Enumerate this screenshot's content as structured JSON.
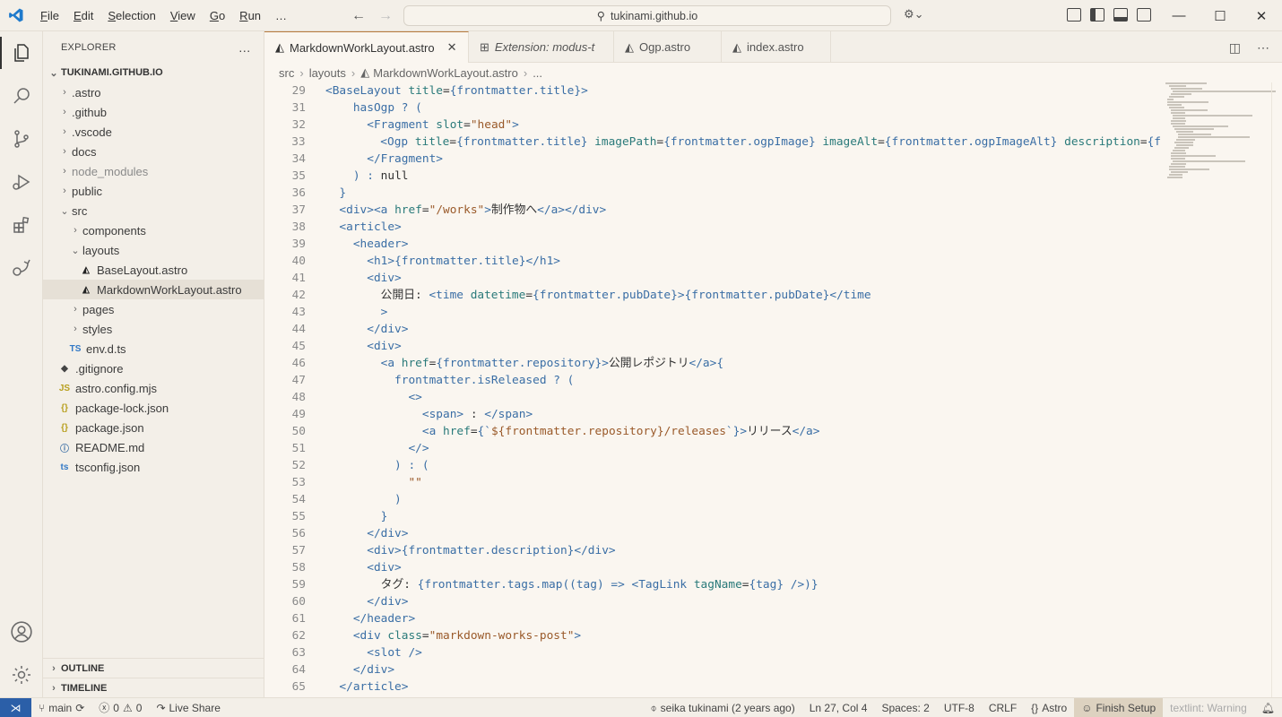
{
  "menu": [
    "File",
    "Edit",
    "Selection",
    "View",
    "Go",
    "Run",
    "…"
  ],
  "menu_mnemonics": [
    "F",
    "E",
    "S",
    "V",
    "G",
    "R",
    ""
  ],
  "search": {
    "text": "tukinami.github.io"
  },
  "sidebar": {
    "header": "EXPLORER",
    "more": "…",
    "root": "TUKINAMI.GITHUB.IO",
    "items": [
      {
        "label": ".astro",
        "type": "folder",
        "depth": 1,
        "open": false
      },
      {
        "label": ".github",
        "type": "folder",
        "depth": 1,
        "open": false
      },
      {
        "label": ".vscode",
        "type": "folder",
        "depth": 1,
        "open": false
      },
      {
        "label": "docs",
        "type": "folder",
        "depth": 1,
        "open": false
      },
      {
        "label": "node_modules",
        "type": "folder",
        "depth": 1,
        "open": false,
        "dim": true
      },
      {
        "label": "public",
        "type": "folder",
        "depth": 1,
        "open": false
      },
      {
        "label": "src",
        "type": "folder",
        "depth": 1,
        "open": true
      },
      {
        "label": "components",
        "type": "folder",
        "depth": 2,
        "open": false
      },
      {
        "label": "layouts",
        "type": "folder",
        "depth": 2,
        "open": true
      },
      {
        "label": "BaseLayout.astro",
        "type": "astro",
        "depth": 3
      },
      {
        "label": "MarkdownWorkLayout.astro",
        "type": "astro",
        "depth": 3,
        "selected": true
      },
      {
        "label": "pages",
        "type": "folder",
        "depth": 2,
        "open": false
      },
      {
        "label": "styles",
        "type": "folder",
        "depth": 2,
        "open": false
      },
      {
        "label": "env.d.ts",
        "type": "ts",
        "depth": 2
      },
      {
        "label": ".gitignore",
        "type": "git",
        "depth": 1
      },
      {
        "label": "astro.config.mjs",
        "type": "js",
        "depth": 1
      },
      {
        "label": "package-lock.json",
        "type": "json",
        "depth": 1
      },
      {
        "label": "package.json",
        "type": "json",
        "depth": 1
      },
      {
        "label": "README.md",
        "type": "info",
        "depth": 1
      },
      {
        "label": "tsconfig.json",
        "type": "tsconfig",
        "depth": 1
      }
    ],
    "outline": "OUTLINE",
    "timeline": "TIMELINE"
  },
  "tabs": [
    {
      "label": "MarkdownWorkLayout.astro",
      "active": true,
      "italic": false,
      "icon": "astro-icon"
    },
    {
      "label": "Extension: modus-t",
      "active": false,
      "italic": true,
      "icon": "extension-icon"
    },
    {
      "label": "Ogp.astro",
      "active": false,
      "italic": false,
      "icon": "astro-icon"
    },
    {
      "label": "index.astro",
      "active": false,
      "italic": false,
      "icon": "astro-icon"
    }
  ],
  "breadcrumb": [
    "src",
    "layouts",
    "MarkdownWorkLayout.astro",
    "..."
  ],
  "code": [
    {
      "n": "29",
      "indent": 0,
      "parts": [
        [
          "tag",
          "<BaseLayout "
        ],
        [
          "attr",
          "title"
        ],
        [
          "plain",
          "="
        ],
        [
          "expr",
          "{frontmatter.title}"
        ],
        [
          "tag",
          ">"
        ]
      ]
    },
    {
      "n": "31",
      "indent": 2,
      "parts": [
        [
          "expr",
          "hasOgp ? ("
        ]
      ]
    },
    {
      "n": "32",
      "indent": 3,
      "parts": [
        [
          "tag",
          "<Fragment "
        ],
        [
          "attr",
          "slot"
        ],
        [
          "plain",
          "="
        ],
        [
          "str",
          "\"head\""
        ],
        [
          "tag",
          ">"
        ]
      ]
    },
    {
      "n": "33",
      "indent": 4,
      "parts": [
        [
          "tag",
          "<Ogp "
        ],
        [
          "attr",
          "title"
        ],
        [
          "plain",
          "="
        ],
        [
          "expr",
          "{frontmatter.title} "
        ],
        [
          "attr",
          "imagePath"
        ],
        [
          "plain",
          "="
        ],
        [
          "expr",
          "{frontmatter.ogpImage} "
        ],
        [
          "attr",
          "imageAlt"
        ],
        [
          "plain",
          "="
        ],
        [
          "expr",
          "{frontmatter.ogpImageAlt} "
        ],
        [
          "attr",
          "description"
        ],
        [
          "plain",
          "="
        ],
        [
          "expr",
          "{f"
        ]
      ]
    },
    {
      "n": "34",
      "indent": 3,
      "parts": [
        [
          "tag",
          "</Fragment>"
        ]
      ]
    },
    {
      "n": "35",
      "indent": 2,
      "parts": [
        [
          "expr",
          ") : "
        ],
        [
          "plain",
          "null"
        ]
      ]
    },
    {
      "n": "36",
      "indent": 1,
      "parts": [
        [
          "expr",
          "}"
        ]
      ]
    },
    {
      "n": "37",
      "indent": 1,
      "parts": [
        [
          "tag",
          "<div><a "
        ],
        [
          "attr",
          "href"
        ],
        [
          "plain",
          "="
        ],
        [
          "str",
          "\"/works\""
        ],
        [
          "tag",
          ">"
        ],
        [
          "plain",
          "制作物へ"
        ],
        [
          "tag",
          "</a></div>"
        ]
      ]
    },
    {
      "n": "38",
      "indent": 1,
      "parts": [
        [
          "tag",
          "<article>"
        ]
      ]
    },
    {
      "n": "39",
      "indent": 2,
      "parts": [
        [
          "tag",
          "<header>"
        ]
      ]
    },
    {
      "n": "40",
      "indent": 3,
      "parts": [
        [
          "tag",
          "<h1>"
        ],
        [
          "expr",
          "{frontmatter.title}"
        ],
        [
          "tag",
          "</h1>"
        ]
      ]
    },
    {
      "n": "41",
      "indent": 3,
      "parts": [
        [
          "tag",
          "<div>"
        ]
      ]
    },
    {
      "n": "42",
      "indent": 4,
      "parts": [
        [
          "plain",
          "公開日: "
        ],
        [
          "tag",
          "<time "
        ],
        [
          "attr",
          "datetime"
        ],
        [
          "plain",
          "="
        ],
        [
          "expr",
          "{frontmatter.pubDate}"
        ],
        [
          "tag",
          ">"
        ],
        [
          "expr",
          "{frontmatter.pubDate}"
        ],
        [
          "tag",
          "</time"
        ]
      ]
    },
    {
      "n": "43",
      "indent": 4,
      "parts": [
        [
          "tag",
          ">"
        ]
      ]
    },
    {
      "n": "44",
      "indent": 3,
      "parts": [
        [
          "tag",
          "</div>"
        ]
      ]
    },
    {
      "n": "45",
      "indent": 3,
      "parts": [
        [
          "tag",
          "<div>"
        ]
      ]
    },
    {
      "n": "46",
      "indent": 4,
      "parts": [
        [
          "tag",
          "<a "
        ],
        [
          "attr",
          "href"
        ],
        [
          "plain",
          "="
        ],
        [
          "expr",
          "{frontmatter.repository}"
        ],
        [
          "tag",
          ">"
        ],
        [
          "plain",
          "公開レポジトリ"
        ],
        [
          "tag",
          "</a>"
        ],
        [
          "expr",
          "{"
        ]
      ]
    },
    {
      "n": "47",
      "indent": 5,
      "parts": [
        [
          "expr",
          "frontmatter.isReleased ? ("
        ]
      ]
    },
    {
      "n": "48",
      "indent": 6,
      "parts": [
        [
          "tag",
          "<>"
        ]
      ]
    },
    {
      "n": "49",
      "indent": 7,
      "parts": [
        [
          "tag",
          "<span>"
        ],
        [
          "plain",
          " : "
        ],
        [
          "tag",
          "</span>"
        ]
      ]
    },
    {
      "n": "50",
      "indent": 7,
      "parts": [
        [
          "tag",
          "<a "
        ],
        [
          "attr",
          "href"
        ],
        [
          "plain",
          "="
        ],
        [
          "expr",
          "{`"
        ],
        [
          "str",
          "${frontmatter.repository}/releases"
        ],
        [
          "expr",
          "`}"
        ],
        [
          "tag",
          ">"
        ],
        [
          "plain",
          "リリース"
        ],
        [
          "tag",
          "</a>"
        ]
      ]
    },
    {
      "n": "51",
      "indent": 6,
      "parts": [
        [
          "tag",
          "</>"
        ]
      ]
    },
    {
      "n": "52",
      "indent": 5,
      "parts": [
        [
          "expr",
          ") : ("
        ]
      ]
    },
    {
      "n": "53",
      "indent": 6,
      "parts": [
        [
          "str",
          "\"\""
        ]
      ]
    },
    {
      "n": "54",
      "indent": 5,
      "parts": [
        [
          "expr",
          ")"
        ]
      ]
    },
    {
      "n": "55",
      "indent": 4,
      "parts": [
        [
          "expr",
          "}"
        ]
      ]
    },
    {
      "n": "56",
      "indent": 3,
      "parts": [
        [
          "tag",
          "</div>"
        ]
      ]
    },
    {
      "n": "57",
      "indent": 3,
      "parts": [
        [
          "tag",
          "<div>"
        ],
        [
          "expr",
          "{frontmatter.description}"
        ],
        [
          "tag",
          "</div>"
        ]
      ]
    },
    {
      "n": "58",
      "indent": 3,
      "parts": [
        [
          "tag",
          "<div>"
        ]
      ]
    },
    {
      "n": "59",
      "indent": 4,
      "parts": [
        [
          "plain",
          "タグ: "
        ],
        [
          "expr",
          "{frontmatter.tags.map((tag) => "
        ],
        [
          "tag",
          "<TagLink "
        ],
        [
          "attr",
          "tagName"
        ],
        [
          "plain",
          "="
        ],
        [
          "expr",
          "{tag} "
        ],
        [
          "tag",
          "/>"
        ],
        [
          "expr",
          ")}"
        ]
      ]
    },
    {
      "n": "60",
      "indent": 3,
      "parts": [
        [
          "tag",
          "</div>"
        ]
      ]
    },
    {
      "n": "61",
      "indent": 2,
      "parts": [
        [
          "tag",
          "</header>"
        ]
      ]
    },
    {
      "n": "62",
      "indent": 2,
      "parts": [
        [
          "tag",
          "<div "
        ],
        [
          "attr",
          "class"
        ],
        [
          "plain",
          "="
        ],
        [
          "str",
          "\"markdown-works-post\""
        ],
        [
          "tag",
          ">"
        ]
      ]
    },
    {
      "n": "63",
      "indent": 3,
      "parts": [
        [
          "tag",
          "<slot />"
        ]
      ]
    },
    {
      "n": "64",
      "indent": 2,
      "parts": [
        [
          "tag",
          "</div>"
        ]
      ]
    },
    {
      "n": "65",
      "indent": 1,
      "parts": [
        [
          "tag",
          "</article>"
        ]
      ]
    }
  ],
  "status": {
    "branch": "main",
    "problems_errors": "0",
    "problems_warnings": "0",
    "live_share": "Live Share",
    "blame": "seika tukinami (2 years ago)",
    "position": "Ln 27, Col 4",
    "spaces": "Spaces: 2",
    "encoding": "UTF-8",
    "eol": "CRLF",
    "language": "Astro",
    "finish_setup": "Finish Setup",
    "lint": "textlint: Warning"
  },
  "colors": {
    "accent": "#2b5fa8",
    "tag": "#3a6ea5",
    "attr": "#2a7a7a",
    "string": "#9a5a2a"
  }
}
